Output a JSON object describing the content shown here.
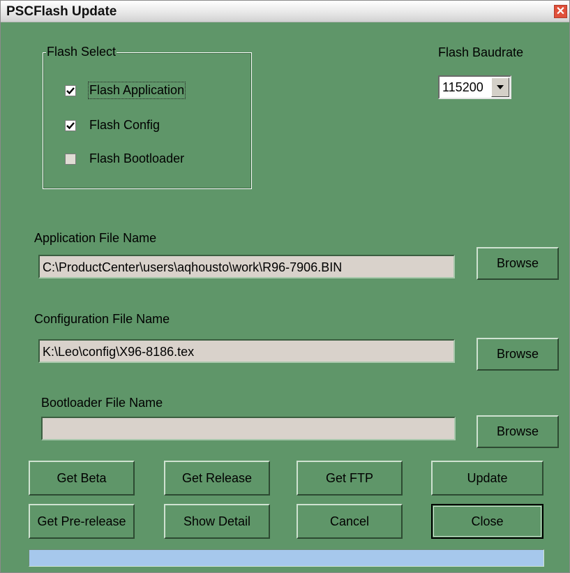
{
  "window": {
    "title": "PSCFlash Update",
    "close_glyph": "✕"
  },
  "flash_select": {
    "group_label": "Flash Select",
    "options": [
      {
        "label": "Flash Application",
        "checked": true
      },
      {
        "label": "Flash Config",
        "checked": true
      },
      {
        "label": "Flash Bootloader",
        "checked": false
      }
    ]
  },
  "baudrate": {
    "label": "Flash Baudrate",
    "value": "115200"
  },
  "application": {
    "label": "Application File Name",
    "value": "C:\\ProductCenter\\users\\aqhousto\\work\\R96-7906.BIN",
    "browse_label": "Browse"
  },
  "configuration": {
    "label": "Configuration File Name",
    "value": "K:\\Leo\\config\\X96-8186.tex",
    "browse_label": "Browse"
  },
  "bootloader": {
    "label": "Bootloader File Name",
    "value": "",
    "browse_label": "Browse"
  },
  "buttons": {
    "get_beta": "Get Beta",
    "get_release": "Get Release",
    "get_ftp": "Get FTP",
    "update": "Update",
    "get_prerelease": "Get Pre-release",
    "show_detail": "Show Detail",
    "cancel": "Cancel",
    "close": "Close"
  },
  "progress": {
    "fraction": 0.0
  },
  "colors": {
    "dialog_bg": "#5f9669",
    "field_bg": "#d9d2cb",
    "progress_track": "#a6c8ec"
  }
}
